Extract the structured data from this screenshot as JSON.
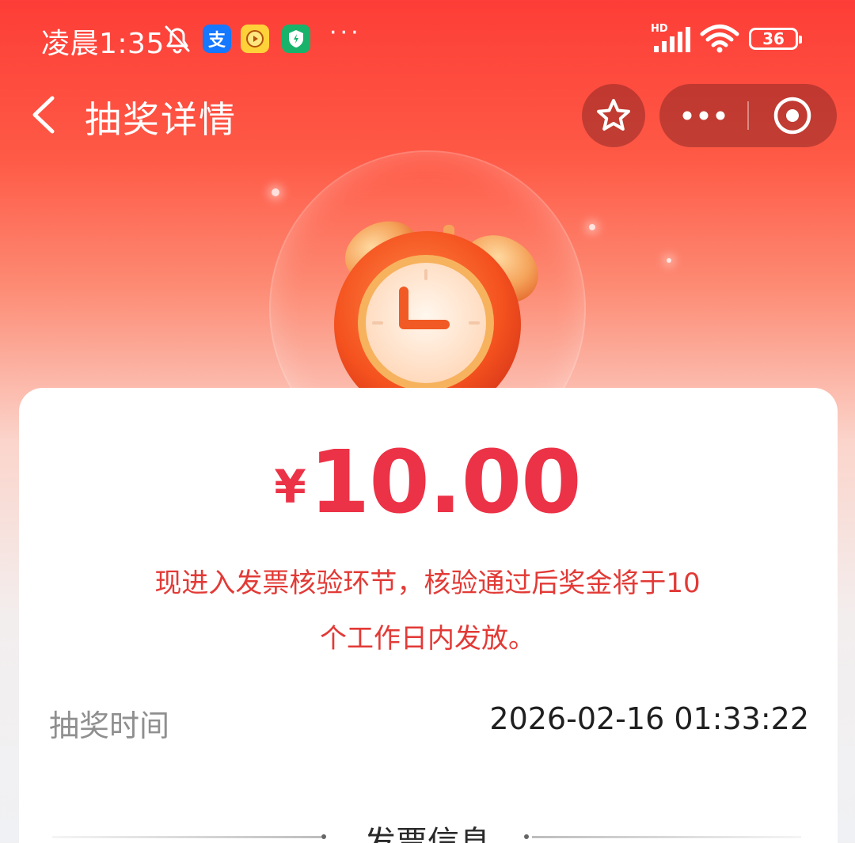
{
  "status_bar": {
    "time": "凌晨1:35",
    "alipay_glyph": "支",
    "hd_label": "HD",
    "battery_level": "36",
    "more_glyph": "···"
  },
  "header": {
    "title": "抽奖详情",
    "back_icon": "chevron-left-icon",
    "favorite_icon": "star-icon",
    "more_icon": "more-dots-icon",
    "close_icon": "target-circle-icon"
  },
  "prize": {
    "currency": "¥",
    "amount": "10.00",
    "notice_line1": "现进入发票核验环节，核验通过后奖金将于10",
    "notice_line2": "个工作日内发放。"
  },
  "details": {
    "draw_time_label": "抽奖时间",
    "draw_time_value": "2026-02-16 01:33:22"
  },
  "invoice_section": {
    "title": "发票信息"
  },
  "colors": {
    "header_red": "#fd3d37",
    "amount_red": "#ec3246",
    "notice_red": "#e23a36"
  }
}
